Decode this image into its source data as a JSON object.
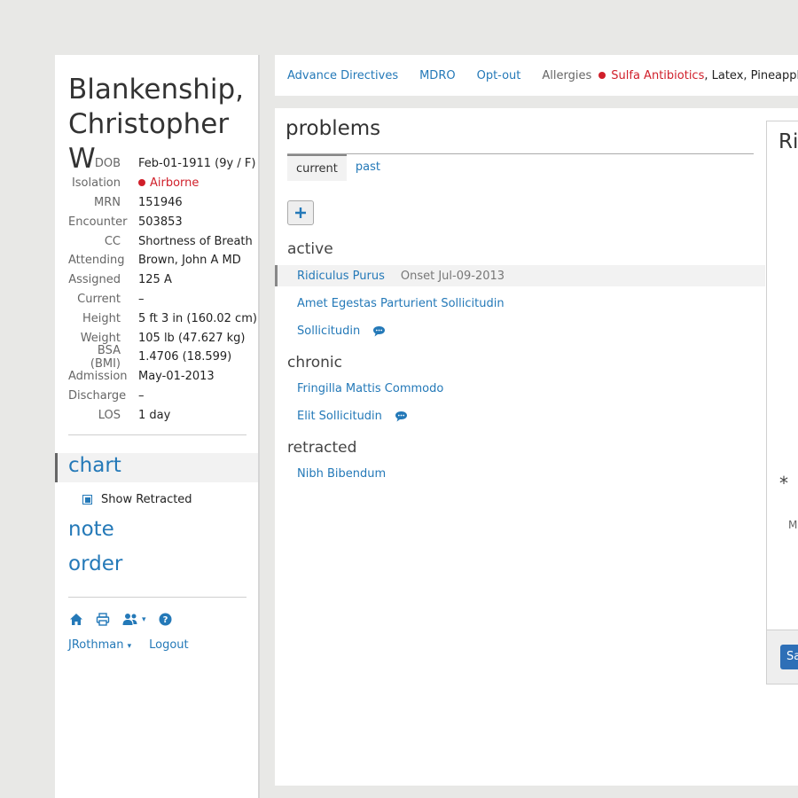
{
  "patient": {
    "last_name": "Blankenship,",
    "first_name": "Christopher W",
    "demographics": [
      {
        "label": "DOB",
        "value": "Feb-01-1911 (9y / F)"
      },
      {
        "label": "Isolation",
        "value": "Airborne",
        "status_color": "#d01f2a"
      },
      {
        "label": "MRN",
        "value": "151946"
      },
      {
        "label": "Encounter",
        "value": "503853"
      },
      {
        "label": "CC",
        "value": "Shortness of Breath"
      },
      {
        "label": "Attending",
        "value": "Brown, John A MD"
      },
      {
        "label": "Assigned",
        "value": "125 A"
      },
      {
        "label": "Current",
        "value": "–"
      },
      {
        "label": "Height",
        "value": "5 ft 3 in (160.02 cm)"
      },
      {
        "label": "Weight",
        "value": "105 lb (47.627 kg)"
      },
      {
        "label": "BSA (BMI)",
        "value": "1.4706 (18.599)"
      },
      {
        "label": "Admission",
        "value": "May-01-2013"
      },
      {
        "label": "Discharge",
        "value": "–"
      },
      {
        "label": "LOS",
        "value": "1 day"
      }
    ]
  },
  "nav": {
    "chart": "chart",
    "show_retracted_label": "Show Retracted",
    "show_retracted_checked": true,
    "note": "note",
    "order": "order",
    "icons": [
      "home-icon",
      "print-icon",
      "users-icon",
      "help-icon"
    ]
  },
  "user": {
    "name": "JRothman",
    "logout": "Logout"
  },
  "topbar": {
    "advance_directives": "Advance Directives",
    "mdro": "MDRO",
    "opt_out": "Opt-out",
    "allergies_label": "Allergies",
    "allergy_critical": "Sulfa Antibiotics",
    "allergy_others": ", Latex, Pineapple, Peanu"
  },
  "problems": {
    "title": "problems",
    "tabs": [
      {
        "label": "current",
        "active": true
      },
      {
        "label": "past",
        "active": false
      }
    ],
    "groups": [
      {
        "heading": "active",
        "items": [
          {
            "label": "Ridiculus Purus",
            "onset": "Onset Jul-09-2013",
            "selected": true,
            "comment": false
          },
          {
            "label": "Amet Egestas Parturient Sollicitudin",
            "onset": "",
            "selected": false,
            "comment": false
          },
          {
            "label": "Sollicitudin",
            "onset": "",
            "selected": false,
            "comment": true
          }
        ]
      },
      {
        "heading": "chronic",
        "items": [
          {
            "label": "Fringilla Mattis Commodo",
            "onset": "",
            "selected": false,
            "comment": false
          },
          {
            "label": "Elit Sollicitudin",
            "onset": "",
            "selected": false,
            "comment": true
          }
        ]
      },
      {
        "heading": "retracted",
        "items": [
          {
            "label": "Nibh Bibendum",
            "onset": "",
            "selected": false,
            "comment": false
          }
        ]
      }
    ]
  },
  "detail": {
    "title_partial": "Ric",
    "required_marker": "*",
    "field_partial": "M",
    "save_partial": "Sa"
  },
  "colors": {
    "link": "#2479b8",
    "critical": "#d01f2a",
    "primary_button": "#2e6fb7"
  }
}
